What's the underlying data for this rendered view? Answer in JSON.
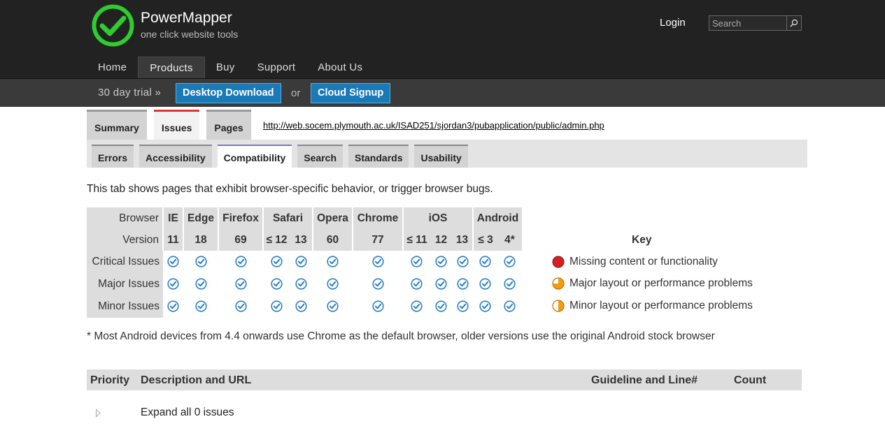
{
  "header": {
    "brand": "PowerMapper",
    "tagline": "one click website tools",
    "login": "Login",
    "search_placeholder": "Search"
  },
  "nav": [
    {
      "label": "Home",
      "active": false
    },
    {
      "label": "Products",
      "active": true
    },
    {
      "label": "Buy",
      "active": false
    },
    {
      "label": "Support",
      "active": false
    },
    {
      "label": "About Us",
      "active": false
    }
  ],
  "trialbar": {
    "trial": "30 day trial »",
    "desktop": "Desktop Download",
    "or": "or",
    "cloud": "Cloud Signup"
  },
  "tabs": {
    "main": [
      {
        "label": "Summary",
        "active": false
      },
      {
        "label": "Issues",
        "active": true
      },
      {
        "label": "Pages",
        "active": false
      }
    ],
    "sub": [
      {
        "label": "Errors",
        "active": false
      },
      {
        "label": "Accessibility",
        "active": false
      },
      {
        "label": "Compatibility",
        "active": true
      },
      {
        "label": "Search",
        "active": false
      },
      {
        "label": "Standards",
        "active": false
      },
      {
        "label": "Usability",
        "active": false
      }
    ]
  },
  "page_url": "http://web.socem.plymouth.ac.uk/ISAD251/sjordan3/pubapplication/public/admin.php",
  "intro": "This tab shows pages that exhibit browser-specific behavior, or trigger browser bugs.",
  "compat": {
    "browser_label": "Browser",
    "version_label": "Version",
    "browsers": [
      {
        "name": "IE",
        "versions": [
          "11"
        ]
      },
      {
        "name": "Edge",
        "versions": [
          "18"
        ]
      },
      {
        "name": "Firefox",
        "versions": [
          "69"
        ]
      },
      {
        "name": "Safari",
        "versions": [
          "≤ 12",
          "13"
        ]
      },
      {
        "name": "Opera",
        "versions": [
          "60"
        ]
      },
      {
        "name": "Chrome",
        "versions": [
          "77"
        ]
      },
      {
        "name": "iOS",
        "versions": [
          "≤ 11",
          "12",
          "13"
        ]
      },
      {
        "name": "Android",
        "versions": [
          "≤ 3",
          "4*"
        ]
      }
    ],
    "rows": [
      "Critical Issues",
      "Major Issues",
      "Minor Issues"
    ]
  },
  "key": {
    "title": "Key",
    "items": [
      {
        "label": "Missing content or functionality",
        "icon": "red-circle-icon",
        "color": "#d42020"
      },
      {
        "label": "Major layout or performance problems",
        "icon": "orange-pie-three-quarter-icon",
        "color": "#f39c12"
      },
      {
        "label": "Minor layout or performance problems",
        "icon": "orange-pie-half-icon",
        "color": "#f39c12"
      }
    ]
  },
  "footnote": "* Most Android devices from 4.4 onwards use Chrome as the default browser, older versions use the original Android stock browser",
  "issues": {
    "col_priority": "Priority",
    "col_description": "Description and URL",
    "col_guideline": "Guideline and Line#",
    "col_count": "Count",
    "expand": "Expand all 0 issues"
  },
  "colors": {
    "header_bg": "#222222",
    "accent_blue": "#1a7ab8",
    "check_blue": "#2a7fc6",
    "active_tab_red": "#d33333"
  }
}
